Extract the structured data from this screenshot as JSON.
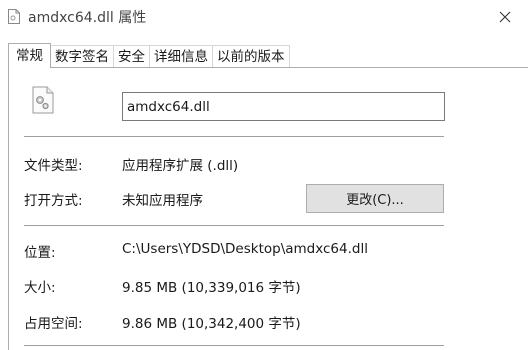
{
  "window": {
    "title": "amdxc64.dll 属性",
    "close_glyph": "✕"
  },
  "tabs": [
    {
      "label": "常规",
      "active": true
    },
    {
      "label": "数字签名",
      "active": false
    },
    {
      "label": "安全",
      "active": false
    },
    {
      "label": "详细信息",
      "active": false
    },
    {
      "label": "以前的版本",
      "active": false
    }
  ],
  "general": {
    "file_name": "amdxc64.dll",
    "file_type_label": "文件类型:",
    "file_type_value": "应用程序扩展 (.dll)",
    "opens_with_label": "打开方式:",
    "opens_with_value": "未知应用程序",
    "change_button": "更改(C)...",
    "location_label": "位置:",
    "location_value": "C:\\Users\\YDSD\\Desktop\\amdxc64.dll",
    "size_label": "大小:",
    "size_value": "9.85 MB (10,339,016 字节)",
    "size_on_disk_label": "占用空间:",
    "size_on_disk_value": "9.86 MB (10,342,400 字节)"
  },
  "icons": {
    "title": "dll-file-icon",
    "file": "dll-gear-file-icon",
    "close": "close-icon"
  }
}
